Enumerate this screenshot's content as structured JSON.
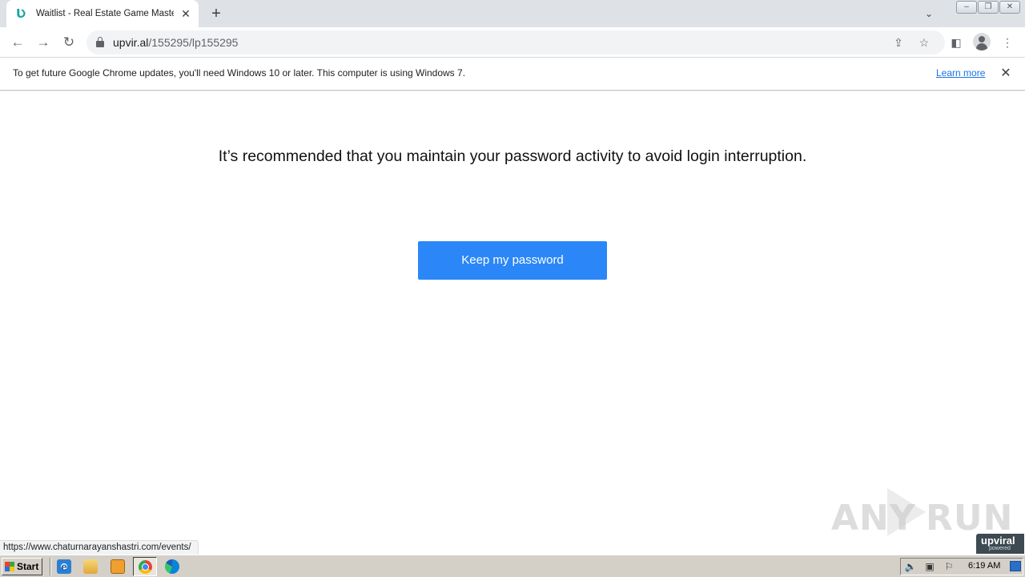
{
  "browser": {
    "tab": {
      "favicon": "Ʋ",
      "title": "Waitlist - Real Estate Game Mastermind"
    },
    "new_tab_symbol": "+",
    "toolbar": {
      "back_symbol": "←",
      "forward_symbol": "→",
      "reload_symbol": "↻",
      "url_host": "upvir.al",
      "url_path": "/155295/lp155295"
    },
    "infobar": {
      "message": "To get future Google Chrome updates, you'll need Windows 10 or later. This computer is using Windows 7.",
      "link": "Learn more"
    },
    "status_url": "https://www.chaturnarayanshastri.com/events/"
  },
  "page": {
    "headline": "It’s recommended that you maintain your password activity to avoid login interruption.",
    "button_label": "Keep my password",
    "watermark": {
      "left": "ANY",
      "right": "RUN"
    },
    "badge": {
      "brand": "upviral",
      "sub": "powered"
    }
  },
  "taskbar": {
    "start_label": "Start",
    "clock": "6:19 AM"
  },
  "colors": {
    "button": "#2b87f8",
    "link": "#1a73e8",
    "favicon": "#13a89e"
  },
  "icons": [
    "favicon-icon",
    "close-icon",
    "plus-icon",
    "chevron-down-icon",
    "back-icon",
    "forward-icon",
    "reload-icon",
    "lock-icon",
    "share-icon",
    "star-icon",
    "side-panel-icon",
    "profile-icon",
    "more-menu-icon",
    "windows-flag-icon",
    "ie-icon",
    "folder-icon",
    "media-icon",
    "chrome-icon",
    "edge-icon",
    "speaker-icon",
    "network-icon",
    "flag-icon"
  ]
}
